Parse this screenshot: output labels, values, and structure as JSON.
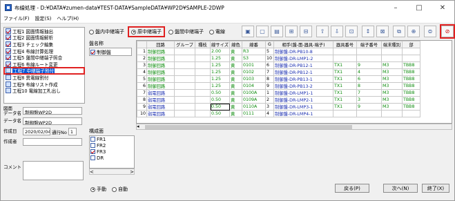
{
  "window": {
    "title": "布線処理 - D:¥DATA¥zumen-data¥TEST-DATA¥SampleDATA¥WP2D¥SAMPLE-2DWP",
    "controls": [
      "–",
      "□",
      "✕"
    ]
  },
  "menu": [
    "ファイル(F)",
    "設定(S)",
    "ヘルプ(H)"
  ],
  "steps": [
    {
      "label": "工程1 図面情報抽出",
      "done": true
    },
    {
      "label": "工程2 図面情報解析",
      "done": true
    },
    {
      "label": "工程3 チェック編集",
      "done": true
    },
    {
      "label": "工程4 布線計算処理",
      "done": true
    },
    {
      "label": "工程5 盤間中継端子照合",
      "done": true
    },
    {
      "label": "工程6 布線ルート変更",
      "done": true
    },
    {
      "label": "工程7 中継端子割付",
      "done": false,
      "selected": true
    },
    {
      "label": "工程8 異電線割付",
      "done": false
    },
    {
      "label": "工程9 布線リスト作成",
      "done": false
    },
    {
      "label": "工程10 電線加工札出し",
      "done": false
    }
  ],
  "info": {
    "drawing_label": "図面\nデータ名",
    "drawing_value": "制御盤WP2D",
    "data_label": "データ名",
    "data_value": "制御盤WP2D",
    "date_label": "作成日",
    "date_value": "2020/02/04",
    "rev_label": "通行No",
    "rev_value": "1",
    "author_label": "作成者",
    "author_value": "",
    "comment_label": "コメント"
  },
  "mode_radios": [
    {
      "label": "盤内中継端子",
      "on": false,
      "hl": false
    },
    {
      "label": "原中継端子",
      "on": true,
      "hl": true
    },
    {
      "label": "盤間中継端子",
      "on": false,
      "hl": false
    },
    {
      "label": "電線",
      "on": false,
      "hl": false
    }
  ],
  "toolbar_icons": [
    "grid-icon",
    "doc-icon",
    "doc2-icon",
    "stack-icon",
    "stack2-icon",
    "up-icon",
    "down-icon",
    "tag-icon",
    "sort-icon",
    "lock-icon",
    "compare-icon",
    "find-icon",
    "filter-icon",
    "delete-icon"
  ],
  "toolbar_glyphs": [
    "▣",
    "▢",
    "▤",
    "⊞",
    "⊟",
    "⇧",
    "⇩",
    "⊡",
    "↕",
    "⊠",
    "⧉",
    "⊕",
    "⊜",
    "⊘"
  ],
  "panel": {
    "label": "盤名称",
    "items": [
      {
        "label": "制御盤",
        "on": true
      }
    ]
  },
  "table": {
    "headers": [
      "",
      "回路",
      "グループ",
      "種枝",
      "線サイズ",
      "線色",
      "線番",
      "G",
      "相手(盤-面-器具-端子)",
      "器具番号",
      "端子番号",
      "端末種別",
      "部"
    ],
    "rows": [
      [
        "1",
        "制御回路",
        "",
        "",
        "2.00",
        "黄",
        "R3",
        "5",
        "制御盤-DR-PB10-8",
        "",
        "",
        "",
        ""
      ],
      [
        "2",
        "制御回路",
        "",
        "",
        "1.25",
        "黄",
        "S3",
        "10",
        "制御盤-DR-LMP1-2",
        "",
        "",
        "",
        ""
      ],
      [
        "3",
        "制御回路",
        "",
        "",
        "1.25",
        "黄",
        "0101",
        "6",
        "制御盤-DR-PB12-1",
        "TX1",
        "9",
        "M3",
        "TBB8"
      ],
      [
        "4",
        "制御回路",
        "",
        "",
        "1.25",
        "黄",
        "0102",
        "7",
        "制御盤-DR-PB12-1",
        "TX1",
        "4",
        "M3",
        "TBB8"
      ],
      [
        "5",
        "制御回路",
        "",
        "",
        "1.25",
        "黄",
        "0103",
        "8",
        "制御盤-DR-PB13-1",
        "TX1",
        "6",
        "M3",
        "TBB8"
      ],
      [
        "6",
        "制御回路",
        "",
        "",
        "1.25",
        "黄",
        "0104",
        "9",
        "制御盤-DR-PB13-2",
        "TX1",
        "8",
        "M3",
        "TBB8"
      ],
      [
        "7",
        "弱電回路",
        "",
        "",
        "0.50",
        "黄",
        "0100A",
        "1",
        "制御盤-DR-LMP1-1",
        "TX1",
        "7",
        "M3",
        "TBB8"
      ],
      [
        "8",
        "弱電回路",
        "",
        "",
        "0.50",
        "黄",
        "0109A",
        "2",
        "制御盤-DR-LMP2-1",
        "TX1",
        "3",
        "M3",
        "TBB8"
      ],
      [
        "9",
        "弱電回路",
        "",
        "",
        "0.50",
        "黄",
        "0110A",
        "3",
        "制御盤-DR-LMP3-1",
        "TX1",
        "9",
        "M3",
        "TBB8"
      ],
      [
        "10",
        "弱電回路",
        "",
        "",
        "0.50",
        "黄",
        "0111",
        "4",
        "制御盤-DR-LMP4-1",
        "",
        "",
        "",
        ""
      ]
    ]
  },
  "composition": {
    "label": "構成面",
    "items": [
      {
        "label": "FR1",
        "on": false
      },
      {
        "label": "FR2",
        "on": false
      },
      {
        "label": "FR3",
        "on": true
      },
      {
        "label": "DR",
        "on": false
      }
    ]
  },
  "exec_radios": [
    {
      "label": "手動",
      "on": true
    },
    {
      "label": "自動",
      "on": false
    }
  ],
  "buttons": {
    "back": "戻る(P)",
    "next": "次へ(N)",
    "finish": "終了(X)"
  },
  "scroll_arrows": {
    "left": "<",
    "right": ">"
  }
}
